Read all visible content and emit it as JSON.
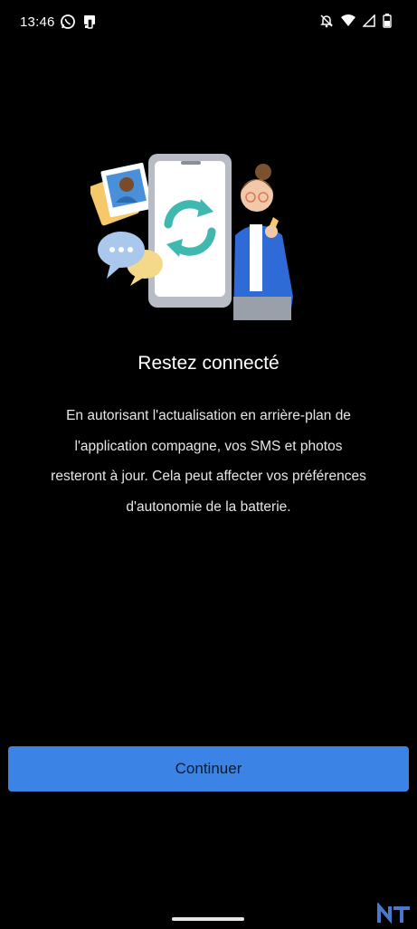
{
  "status_bar": {
    "time": "13:46",
    "left_icons": [
      "whatsapp-icon",
      "phone-link-icon"
    ],
    "right_icons": [
      "notifications-off-icon",
      "wifi-icon",
      "signal-icon",
      "battery-icon"
    ]
  },
  "onboarding": {
    "title": "Restez connecté",
    "body_lines": [
      "En autorisant l'actualisation en arrière-plan de",
      "l'application compagne, vos SMS et photos",
      "resteront à jour. Cela peut affecter vos préférences",
      "d'autonomie de la batterie."
    ],
    "illustration_icon": "phone-sync-illustration"
  },
  "actions": {
    "continue_label": "Continuer"
  },
  "colors": {
    "background": "#000000",
    "accent": "#3b84e6",
    "sync_arrows": "#3fb8b0"
  }
}
